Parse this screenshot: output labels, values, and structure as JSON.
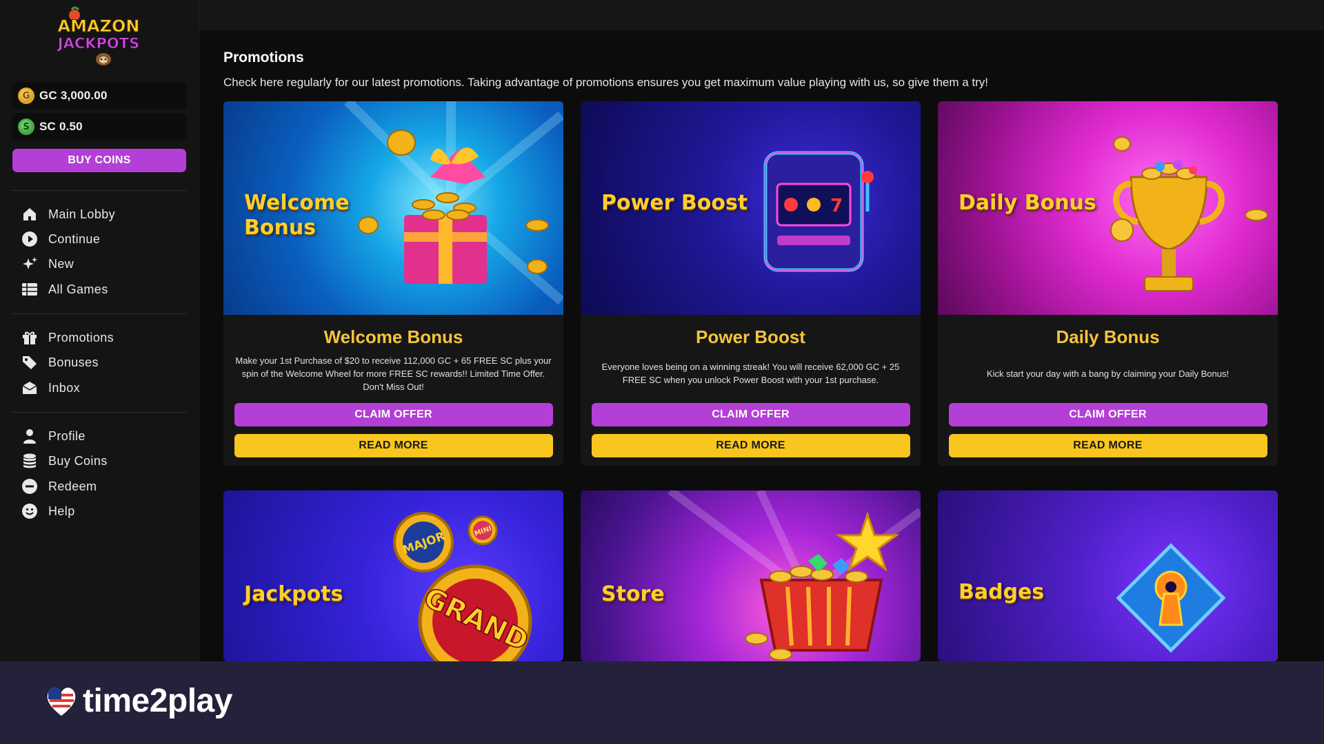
{
  "sidebar": {
    "logo": {
      "line1": "AMAZON",
      "line2": "JACKPOTS"
    },
    "balances": [
      {
        "code": "GC",
        "text": "GC 3,000.00",
        "icon": "gc-coin-icon"
      },
      {
        "code": "SC",
        "text": "SC 0.50",
        "icon": "sc-coin-icon"
      }
    ],
    "buy_coins_label": "BUY COINS",
    "nav": [
      {
        "label": "Main Lobby",
        "icon": "home-icon"
      },
      {
        "label": "Continue",
        "icon": "play-icon"
      },
      {
        "label": "New",
        "icon": "sparkle-icon"
      },
      {
        "label": "All Games",
        "icon": "grid-icon"
      },
      {
        "label": "Promotions",
        "icon": "gift-icon"
      },
      {
        "label": "Bonuses",
        "icon": "tag-icon"
      },
      {
        "label": "Inbox",
        "icon": "envelope-icon"
      },
      {
        "label": "Profile",
        "icon": "person-icon"
      },
      {
        "label": "Buy Coins",
        "icon": "coin-stack-icon"
      },
      {
        "label": "Redeem",
        "icon": "redeem-icon"
      },
      {
        "label": "Help",
        "icon": "smiley-icon"
      }
    ]
  },
  "main": {
    "title": "Promotions",
    "description": "Check here regularly for our latest promotions. Taking advantage of promotions ensures you get maximum value playing with us, so give them a try!",
    "cards": [
      {
        "banner_line1": "Welcome",
        "banner_line2": "Bonus",
        "title": "Welcome Bonus",
        "description": "Make your 1st Purchase of $20 to receive 112,000 GC + 65 FREE SC plus your spin of the Welcome Wheel for more FREE SC rewards!! Limited Time Offer. Don't Miss Out!",
        "claim_label": "CLAIM OFFER",
        "read_label": "READ MORE"
      },
      {
        "banner_line1": "Power Boost",
        "banner_line2": "",
        "title": "Power Boost",
        "description": "Everyone loves being on a winning streak! You will receive 62,000 GC + 25 FREE SC when you unlock Power Boost with your 1st purchase.",
        "claim_label": "CLAIM OFFER",
        "read_label": "READ MORE"
      },
      {
        "banner_line1": "Daily Bonus",
        "banner_line2": "",
        "title": "Daily Bonus",
        "description": "Kick start your day with a bang by claiming your Daily Bonus!",
        "claim_label": "CLAIM OFFER",
        "read_label": "READ MORE"
      }
    ],
    "lower_cards": [
      {
        "banner": "Jackpots",
        "badge_major": "MAJOR",
        "badge_mini": "MINI",
        "badge_grand": "GRAND"
      },
      {
        "banner": "Store"
      },
      {
        "banner": "Badges"
      }
    ]
  },
  "watermark": {
    "text": "time2play"
  },
  "colors": {
    "purple": "#b43fd6",
    "yellow": "#f9c61f",
    "gold_title": "#f5c33b"
  }
}
